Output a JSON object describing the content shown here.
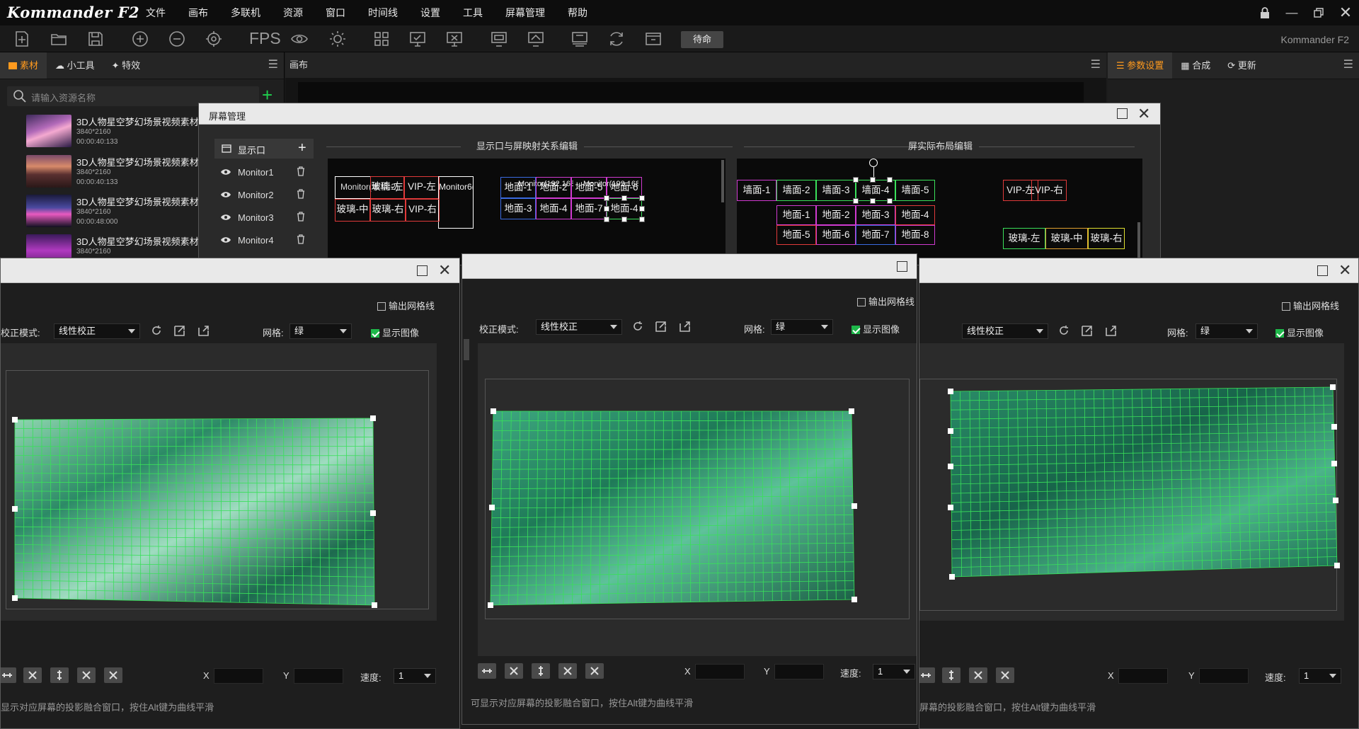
{
  "app": {
    "logo": "Kommander F2",
    "name": "Kommander F2"
  },
  "menu": [
    "文件",
    "画布",
    "多联机",
    "资源",
    "窗口",
    "时间线",
    "设置",
    "工具",
    "屏幕管理",
    "帮助"
  ],
  "toolbar": {
    "fps_label": "FPS",
    "standby_label": "待命"
  },
  "left_panel": {
    "tabs": [
      "素材",
      "小工具",
      "特效"
    ],
    "search_placeholder": "请输入资源名称",
    "assets": [
      {
        "title": "3D人物星空梦幻场景视频素材",
        "res": "3840*2160",
        "duration": "00:00:40:133"
      },
      {
        "title": "3D人物星空梦幻场景视频素材",
        "res": "3840*2160",
        "duration": "00:00:40:133"
      },
      {
        "title": "3D人物星空梦幻场景视频素材",
        "res": "3840*2160",
        "duration": "00:00:48:000"
      },
      {
        "title": "3D人物星空梦幻场景视频素材",
        "res": "3840*2160",
        "duration": ""
      }
    ]
  },
  "canvas_panel": {
    "title": "画布"
  },
  "right_panel": {
    "tabs": [
      "参数设置",
      "合成",
      "更新"
    ]
  },
  "screen_manager": {
    "title": "屏幕管理",
    "display_header": "显示口",
    "monitors": [
      "Monitor1",
      "Monitor2",
      "Monitor3",
      "Monitor4"
    ],
    "section_mapping": "显示口与屏映射关系编辑",
    "section_layout": "屏实际布局编辑",
    "mapping_cells_a": [
      "Monitor(本机:2)",
      "玻璃-左",
      "VIP-左",
      "Monitor6(本机:3)",
      "玻璃-中",
      "玻璃-右",
      "VIP-右"
    ],
    "mapping_cells_b": [
      "地面-1",
      "Monitor(192.168",
      "地面-2",
      "地面-5",
      "Monitor(192.168",
      "地面-6",
      "地面-3",
      "地面-4",
      "地面-7",
      "地面-4"
    ],
    "layout_cells": [
      "墙面-1",
      "墙面-2",
      "墙面-3",
      "墙面-4",
      "墙面-5",
      "地面-1",
      "地面-2",
      "地面-3",
      "地面-4",
      "地面-5",
      "地面-6",
      "地面-7",
      "地面-8",
      "VIP-左",
      "VIP-右",
      "玻璃-左",
      "玻璃-中",
      "玻璃-右"
    ]
  },
  "projection_windows": [
    {
      "output_grid": "输出网格线",
      "mode_label": "校正模式:",
      "mode_value": "线性校正",
      "grid_label": "网格:",
      "grid_value": "绿",
      "show_image": "显示图像",
      "x_label": "X",
      "y_label": "Y",
      "speed_label": "速度:",
      "speed_value": "1",
      "hint": "显示对应屏幕的投影融合窗口，按住Alt键为曲线平滑"
    },
    {
      "output_grid": "输出网格线",
      "mode_label": "校正模式:",
      "mode_value": "线性校正",
      "grid_label": "网格:",
      "grid_value": "绿",
      "show_image": "显示图像",
      "x_label": "X",
      "y_label": "Y",
      "speed_label": "速度:",
      "speed_value": "1",
      "hint": "可显示对应屏幕的投影融合窗口，按住Alt键为曲线平滑"
    },
    {
      "output_grid": "输出网格线",
      "mode_label": "",
      "mode_value": "线性校正",
      "grid_label": "网格:",
      "grid_value": "绿",
      "show_image": "显示图像",
      "x_label": "X",
      "y_label": "Y",
      "speed_label": "速度:",
      "speed_value": "1",
      "hint": "屏幕的投影融合窗口，按住Alt键为曲线平滑"
    }
  ]
}
